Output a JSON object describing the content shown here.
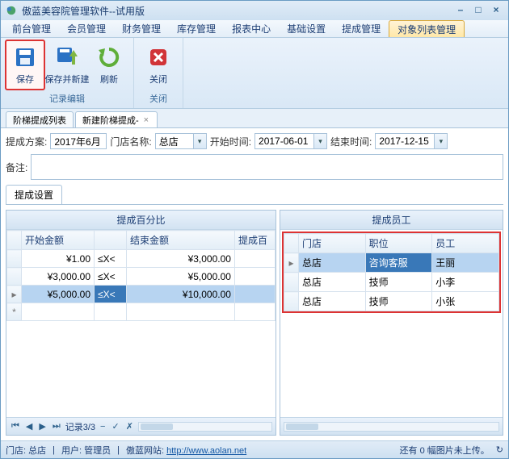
{
  "window": {
    "title": "傲蓝美容院管理软件--试用版"
  },
  "menubar": {
    "items": [
      "前台管理",
      "会员管理",
      "财务管理",
      "库存管理",
      "报表中心",
      "基础设置",
      "提成管理",
      "对象列表管理"
    ],
    "active_index": 7
  },
  "ribbon": {
    "groups": [
      {
        "title": "记录编辑",
        "buttons": [
          {
            "label": "保存",
            "icon": "save-icon",
            "highlight": true
          },
          {
            "label": "保存并新建",
            "icon": "save-new-icon",
            "highlight": false
          },
          {
            "label": "刷新",
            "icon": "refresh-icon",
            "highlight": false
          }
        ]
      },
      {
        "title": "关闭",
        "buttons": [
          {
            "label": "关闭",
            "icon": "close-icon",
            "highlight": false
          }
        ]
      }
    ]
  },
  "doc_tabs": [
    {
      "label": "阶梯提成列表",
      "active": false,
      "closable": false
    },
    {
      "label": "新建阶梯提成-",
      "active": true,
      "closable": true
    }
  ],
  "form": {
    "plan_label": "提成方案:",
    "plan_value": "2017年6月",
    "store_label": "门店名称:",
    "store_value": "总店",
    "start_label": "开始时间:",
    "start_value": "2017-06-01",
    "end_label": "结束时间:",
    "end_value": "2017-12-15",
    "remark_label": "备注:",
    "remark_value": ""
  },
  "inner_tabs": [
    "提成设置"
  ],
  "percent_grid": {
    "title": "提成百分比",
    "columns": [
      "开始金额",
      "",
      "结束金额",
      "提成百"
    ],
    "rows": [
      {
        "start": "¥1.00",
        "op": "≤X<",
        "end": "¥3,000.00",
        "pct": ""
      },
      {
        "start": "¥3,000.00",
        "op": "≤X<",
        "end": "¥5,000.00",
        "pct": ""
      },
      {
        "start": "¥5,000.00",
        "op": "≤X<",
        "end": "¥10,000.00",
        "pct": "",
        "selected": true
      }
    ]
  },
  "emp_grid": {
    "title": "提成员工",
    "columns": [
      "门店",
      "职位",
      "员工"
    ],
    "rows": [
      {
        "store": "总店",
        "role": "咨询客服",
        "emp": "王丽",
        "selected": true
      },
      {
        "store": "总店",
        "role": "技师",
        "emp": "小李"
      },
      {
        "store": "总店",
        "role": "技师",
        "emp": "小张"
      }
    ]
  },
  "pager": {
    "text": "记录3/3"
  },
  "statusbar": {
    "store_label": "门店: ",
    "store": "总店",
    "user_label": "用户: ",
    "user": "管理员",
    "site_label": "傲蓝网站: ",
    "site_url": "http://www.aolan.net",
    "upload_msg": "还有 0 幅图片未上传。"
  }
}
